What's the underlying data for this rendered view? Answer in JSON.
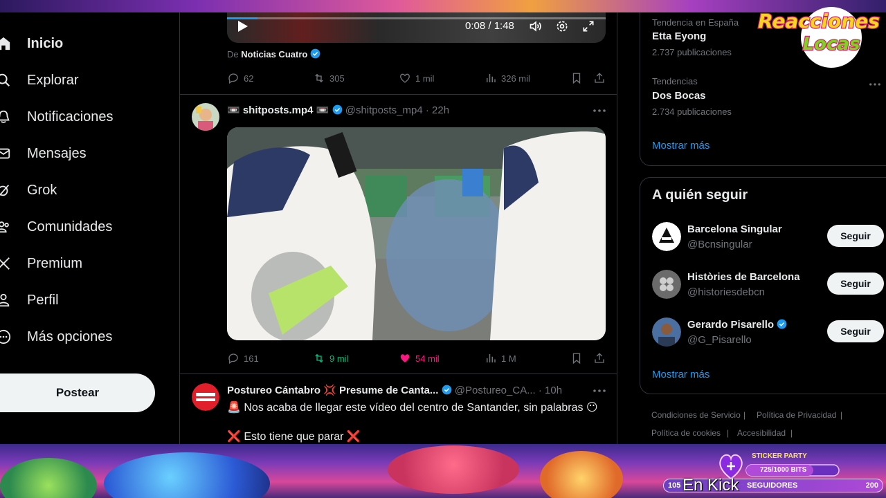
{
  "nav": {
    "items": [
      {
        "label": "Inicio",
        "icon": "home-icon"
      },
      {
        "label": "Explorar",
        "icon": "search-icon"
      },
      {
        "label": "Notificaciones",
        "icon": "bell-icon"
      },
      {
        "label": "Mensajes",
        "icon": "envelope-icon"
      },
      {
        "label": "Grok",
        "icon": "grok-icon"
      },
      {
        "label": "Comunidades",
        "icon": "people-icon"
      },
      {
        "label": "Premium",
        "icon": "x-logo-icon"
      },
      {
        "label": "Perfil",
        "icon": "person-icon"
      },
      {
        "label": "Más opciones",
        "icon": "more-circle-icon"
      }
    ],
    "post_label": "Postear"
  },
  "tweet1": {
    "video": {
      "time": "0:08 / 1:48",
      "progress": 0.08
    },
    "source_prefix": "De",
    "source_name": "Noticias Cuatro",
    "replies": "62",
    "reposts": "305",
    "likes": "1 mil",
    "views": "326 mil"
  },
  "tweet2": {
    "name": "📼 shitposts.mp4 📼",
    "handle": "@shitposts_mp4",
    "time": "· 22h",
    "replies": "161",
    "reposts": "9 mil",
    "likes": "54 mil",
    "views": "1 M"
  },
  "tweet3": {
    "name": "Postureo Cántabro 💢 Presume de Canta...",
    "handle": "@Postureo_CA...",
    "time": "· 10h",
    "line1": "🚨 Nos acaba de llegar este vídeo del centro de Santander, sin palabras 😶",
    "line2": "❌ Esto tiene que parar ❌"
  },
  "trends": [
    {
      "context": "Tendencia en España",
      "name": "Etta Eyong",
      "count": "2.737 publicaciones"
    },
    {
      "context": "Tendencias",
      "name": "Dos Bocas",
      "count": "2.734 publicaciones"
    }
  ],
  "trends_show_more": "Mostrar más",
  "who_to_follow": {
    "title": "A quién seguir",
    "accounts": [
      {
        "name": "Barcelona Singular",
        "handle": "@Bcnsingular",
        "button": "Seguir"
      },
      {
        "name": "Històries de Barcelona",
        "handle": "@historiesdebcn",
        "button": "Seguir"
      },
      {
        "name": "Gerardo Pisarello",
        "handle": "@G_Pisarello",
        "button": "Seguir"
      }
    ],
    "show_more": "Mostrar más"
  },
  "footer": {
    "links": [
      "Condiciones de Servicio",
      "Política de Privacidad",
      "Política de cookies",
      "Accesibilidad"
    ]
  },
  "overlay": {
    "logo_text": "Reacciones Locas",
    "sticker_title": "STICKER PARTY",
    "sticker_bits": "725/1000 BITS",
    "followers_left": "105",
    "followers_label": "SEGUIDORES",
    "followers_right": "200",
    "kick_text": "En Kick"
  },
  "colors": {
    "accent": "#1d9bf0",
    "like": "#f91880",
    "repost": "#00ba7c"
  }
}
